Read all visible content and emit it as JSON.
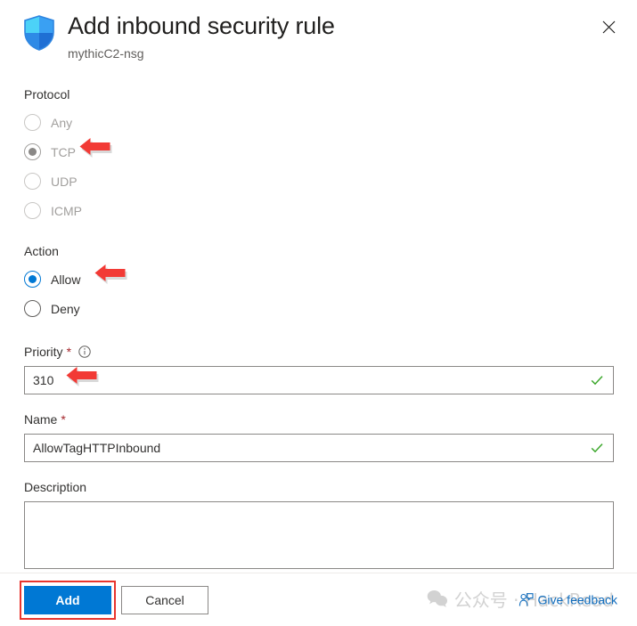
{
  "header": {
    "icon": "shield-icon",
    "title": "Add inbound security rule",
    "subtitle": "mythicC2-nsg",
    "close_icon": "close-icon",
    "close_label": "Close"
  },
  "form": {
    "protocol": {
      "label": "Protocol",
      "disabled": true,
      "selected": "TCP",
      "options": [
        {
          "label": "Any",
          "checked": false,
          "disabled": true
        },
        {
          "label": "TCP",
          "checked": true,
          "disabled": true
        },
        {
          "label": "UDP",
          "checked": false,
          "disabled": true
        },
        {
          "label": "ICMP",
          "checked": false,
          "disabled": true
        }
      ]
    },
    "action": {
      "label": "Action",
      "selected": "Allow",
      "options": [
        {
          "label": "Allow",
          "checked": true
        },
        {
          "label": "Deny",
          "checked": false
        }
      ]
    },
    "priority": {
      "label": "Priority",
      "required_marker": "*",
      "info_icon": "info-circle-icon",
      "value": "310",
      "placeholder": "",
      "valid": true,
      "valid_icon": "checkmark-icon"
    },
    "name": {
      "label": "Name",
      "required_marker": "*",
      "value": "AllowTagHTTPInbound",
      "placeholder": "",
      "valid": true,
      "valid_icon": "checkmark-icon"
    },
    "description": {
      "label": "Description",
      "value": "",
      "placeholder": ""
    }
  },
  "footer": {
    "add_label": "Add",
    "cancel_label": "Cancel",
    "feedback_label": "Give feedback",
    "feedback_icon": "person-feedback-icon"
  },
  "watermark": {
    "text": "公众号 · HackRead",
    "icon": "wechat-icon"
  },
  "annotations": {
    "arrows": [
      {
        "id": "arrow-tcp",
        "points_at": "TCP",
        "direction": "left"
      },
      {
        "id": "arrow-allow",
        "points_at": "Allow",
        "direction": "left"
      },
      {
        "id": "arrow-prio",
        "points_at": "Priority",
        "direction": "left"
      }
    ],
    "highlight_box": {
      "target": "Add",
      "color": "#e8352e"
    }
  },
  "colors": {
    "accent": "#0078d4",
    "required": "#a4262c",
    "valid": "#3ba72b",
    "annotation": "#f23a35",
    "disabled_text": "#a19f9d"
  }
}
